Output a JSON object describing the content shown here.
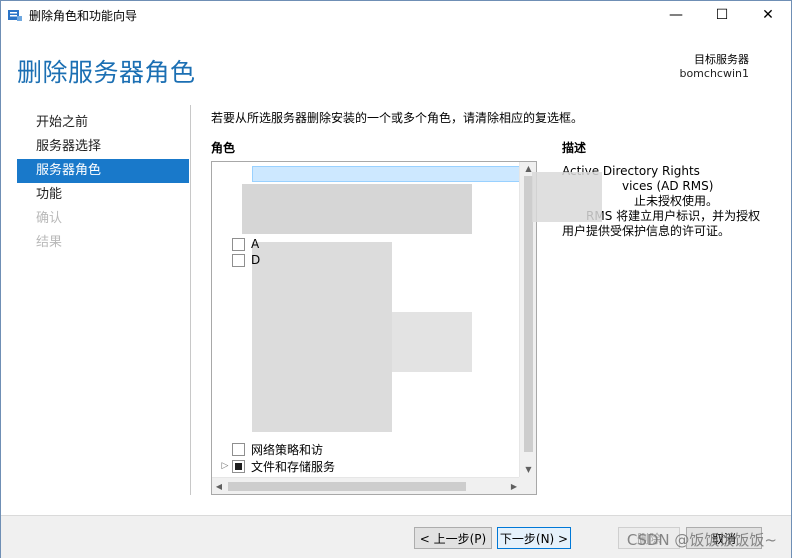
{
  "window": {
    "title": "删除角色和功能向导",
    "controls": {
      "minimize": "—",
      "maximize": "☐",
      "close": "✕"
    }
  },
  "header": {
    "page_title": "删除服务器角色",
    "destination_label": "目标服务器",
    "destination_value": "bomchcwin1"
  },
  "nav": {
    "items": [
      {
        "label": "开始之前",
        "state": "normal"
      },
      {
        "label": "服务器选择",
        "state": "normal"
      },
      {
        "label": "服务器角色",
        "state": "active"
      },
      {
        "label": "功能",
        "state": "normal"
      },
      {
        "label": "确认",
        "state": "disabled"
      },
      {
        "label": "结果",
        "state": "disabled"
      }
    ]
  },
  "main": {
    "instruction": "若要从所选服务器删除安装的一个或多个角色，请清除相应的复选框。",
    "roles_header": "角色",
    "description_header": "描述",
    "visible_rows": [
      {
        "label": "A",
        "checkbox": "empty"
      },
      {
        "label": "D",
        "checkbox": "empty"
      },
      {
        "label": "网络策略和访",
        "checkbox": "empty"
      },
      {
        "label": "文件和存储服务",
        "checkbox": "partial",
        "expandable": true
      }
    ],
    "description_lines": [
      "Active Directory Rights",
      "vices (AD RMS)",
      "止未授权使用。",
      "RMS 将建立用户标识，并为授权",
      "用户提供受保护信息的许可证。"
    ]
  },
  "footer": {
    "prev_label": "< 上一步(P)",
    "next_label": "下一步(N) >",
    "remove_label": "删除",
    "cancel_label": "取消",
    "watermark": "CSDN @饭饭饭饭饭~"
  }
}
